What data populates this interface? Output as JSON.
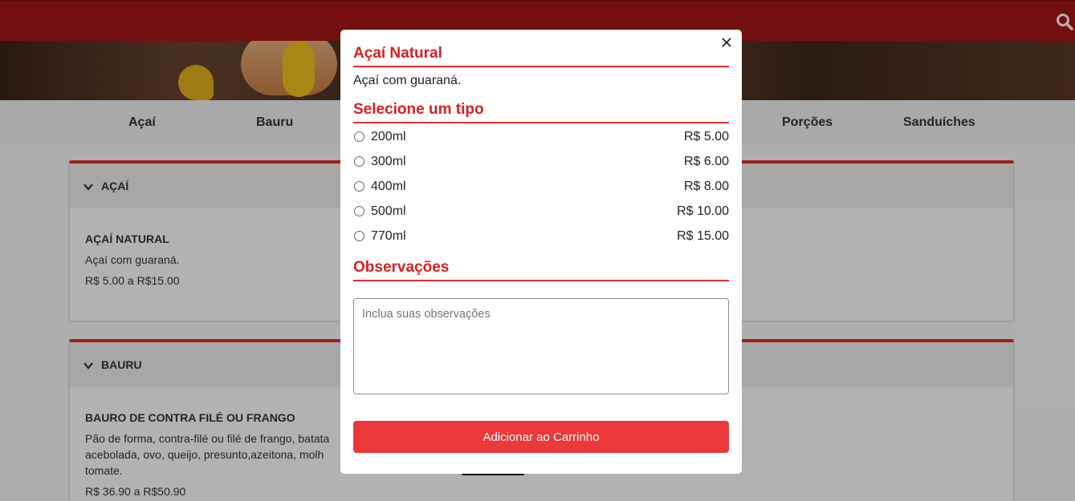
{
  "colors": {
    "topbar": "#a51616",
    "accent": "#e52b2b",
    "button": "#ec3838",
    "title": "#d91f1f"
  },
  "header": {
    "search_icon": "search-icon"
  },
  "categories": [
    {
      "label": "Açaí"
    },
    {
      "label": "Bauru"
    },
    {
      "label": "Porções"
    },
    {
      "label": "Sanduíches"
    }
  ],
  "sections": [
    {
      "title": "AÇAÍ",
      "item": {
        "name": "AÇAÍ NATURAL",
        "desc": "Açaí com guaraná.",
        "price": "R$ 5.00 a R$15.00"
      }
    },
    {
      "title": "BAURU",
      "item": {
        "name": "BAURO DE CONTRA FILÉ OU FRANGO",
        "desc": "Pão de forma, contra-filé ou filé de frango, batata acebolada, ovo, queijo, presunto,azeitona, molh tomate.",
        "price": "R$ 36.90 a R$50.90"
      }
    }
  ],
  "modal": {
    "title": "Açaí Natural",
    "description": "Açaí com guaraná.",
    "type_heading": "Selecione um tipo",
    "options": [
      {
        "label": "200ml",
        "price": "R$ 5.00"
      },
      {
        "label": "300ml",
        "price": "R$ 6.00"
      },
      {
        "label": "400ml",
        "price": "R$ 8.00"
      },
      {
        "label": "500ml",
        "price": "R$ 10.00"
      },
      {
        "label": "770ml",
        "price": "R$ 15.00"
      }
    ],
    "notes_heading": "Observações",
    "notes_placeholder": "Inclua suas observações",
    "notes_value": "",
    "add_button": "Adicionar ao Carrinho",
    "close_icon": "close-icon"
  }
}
